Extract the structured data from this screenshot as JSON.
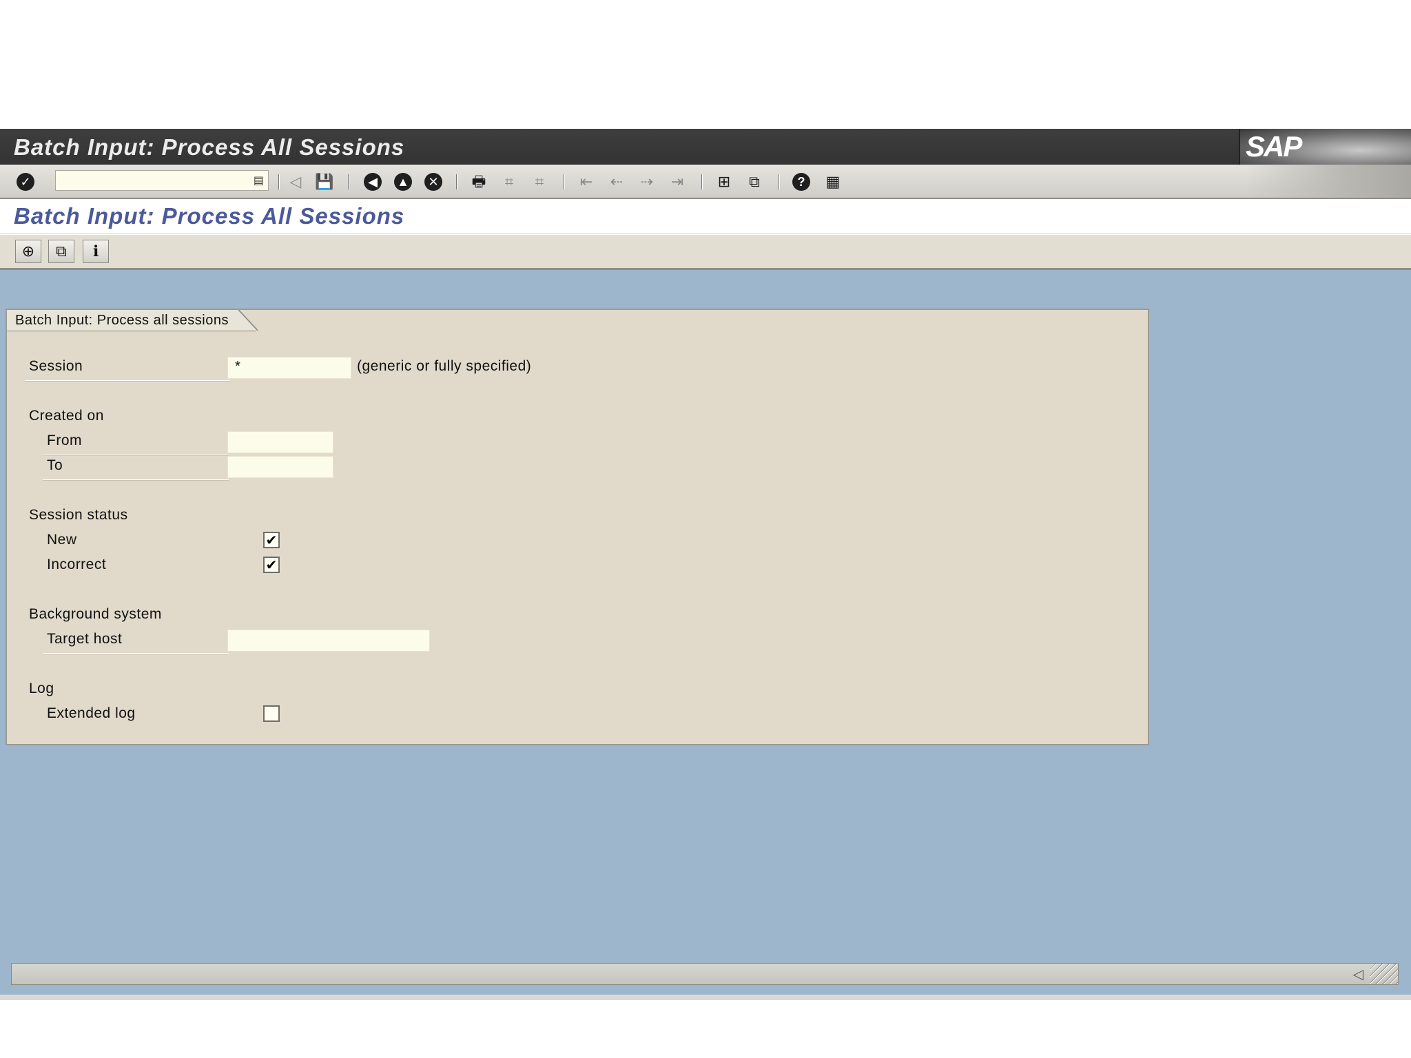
{
  "window": {
    "title": "Batch Input: Process All Sessions",
    "logo": "SAP"
  },
  "system_toolbar": {
    "command_field_value": "",
    "icons": [
      "enter-icon",
      "back-icon",
      "save-icon",
      "back-nav-icon",
      "exit-icon",
      "cancel-icon",
      "print-icon",
      "find-icon",
      "find-next-icon",
      "first-page-icon",
      "previous-page-icon",
      "next-page-icon",
      "last-page-icon",
      "create-session-icon",
      "shortcut-icon",
      "help-icon",
      "layout-menu-icon"
    ]
  },
  "screen": {
    "title": "Batch Input: Process All Sessions"
  },
  "app_toolbar": {
    "icons": [
      "execute-icon",
      "variants-icon",
      "info-icon"
    ]
  },
  "group": {
    "title": "Batch Input: Process all sessions",
    "session_label": "Session",
    "session_value": "*",
    "session_hint": "(generic or fully specified)",
    "created_on_label": "Created on",
    "from_label": "From",
    "from_value": "",
    "to_label": "To",
    "to_value": "",
    "status_label": "Session status",
    "new_label": "New",
    "new_checked": true,
    "incorrect_label": "Incorrect",
    "incorrect_checked": true,
    "background_label": "Background system",
    "target_host_label": "Target host",
    "target_host_value": "",
    "log_label": "Log",
    "extended_log_label": "Extended log",
    "extended_log_checked": false
  },
  "colors": {
    "title_text": "#4a5a9a",
    "content_bg": "#9eb6cc",
    "group_bg": "#e1dacb",
    "input_bg": "#fdfbe9"
  }
}
